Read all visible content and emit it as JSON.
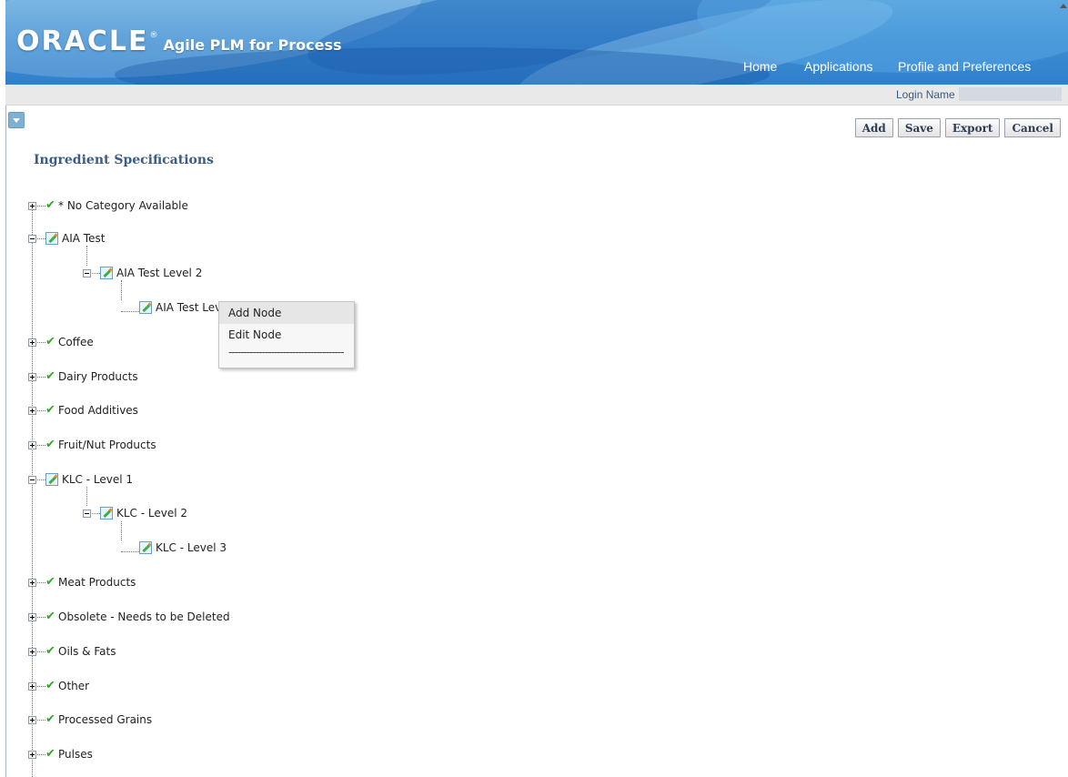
{
  "header": {
    "brand": "ORACLE",
    "brand_mark": "®",
    "product": "Agile PLM for Process",
    "nav": [
      "Home",
      "Applications",
      "Profile and Preferences"
    ]
  },
  "loginbar": {
    "label": "Login Name"
  },
  "toolbar": {
    "add": "Add",
    "save": "Save",
    "export": "Export",
    "cancel": "Cancel"
  },
  "page": {
    "title": "Ingredient Specifications"
  },
  "tree": [
    {
      "label": "* No Category Available",
      "icon": "check-icon",
      "state": "collapsed"
    },
    {
      "label": "AIA Test",
      "icon": "edit-icon",
      "state": "expanded"
    },
    {
      "label": "AIA Test Level 2",
      "icon": "edit-icon",
      "state": "expanded"
    },
    {
      "label": "AIA Test Level 3",
      "icon": "edit-icon",
      "state": "leaf"
    },
    {
      "label": "Coffee",
      "icon": "check-icon",
      "state": "collapsed"
    },
    {
      "label": "Dairy Products",
      "icon": "check-icon",
      "state": "collapsed"
    },
    {
      "label": "Food Additives",
      "icon": "check-icon",
      "state": "collapsed"
    },
    {
      "label": "Fruit/Nut Products",
      "icon": "check-icon",
      "state": "collapsed"
    },
    {
      "label": "KLC - Level 1",
      "icon": "edit-icon",
      "state": "expanded"
    },
    {
      "label": "KLC - Level 2",
      "icon": "edit-icon",
      "state": "expanded"
    },
    {
      "label": "KLC - Level 3",
      "icon": "edit-icon",
      "state": "leaf"
    },
    {
      "label": "Meat Products",
      "icon": "check-icon",
      "state": "collapsed"
    },
    {
      "label": "Obsolete - Needs to be Deleted",
      "icon": "check-icon",
      "state": "collapsed"
    },
    {
      "label": "Oils & Fats",
      "icon": "check-icon",
      "state": "collapsed"
    },
    {
      "label": "Other",
      "icon": "check-icon",
      "state": "collapsed"
    },
    {
      "label": "Processed Grains",
      "icon": "check-icon",
      "state": "collapsed"
    },
    {
      "label": "Pulses",
      "icon": "check-icon",
      "state": "collapsed"
    }
  ],
  "context_menu": {
    "items": [
      "Add Node",
      "Edit Node"
    ],
    "separator": "--------------------------------------"
  },
  "colors": {
    "header_blue": "#3f8fd3",
    "title_blue": "#3a5c86",
    "check_green": "#36a12e"
  }
}
